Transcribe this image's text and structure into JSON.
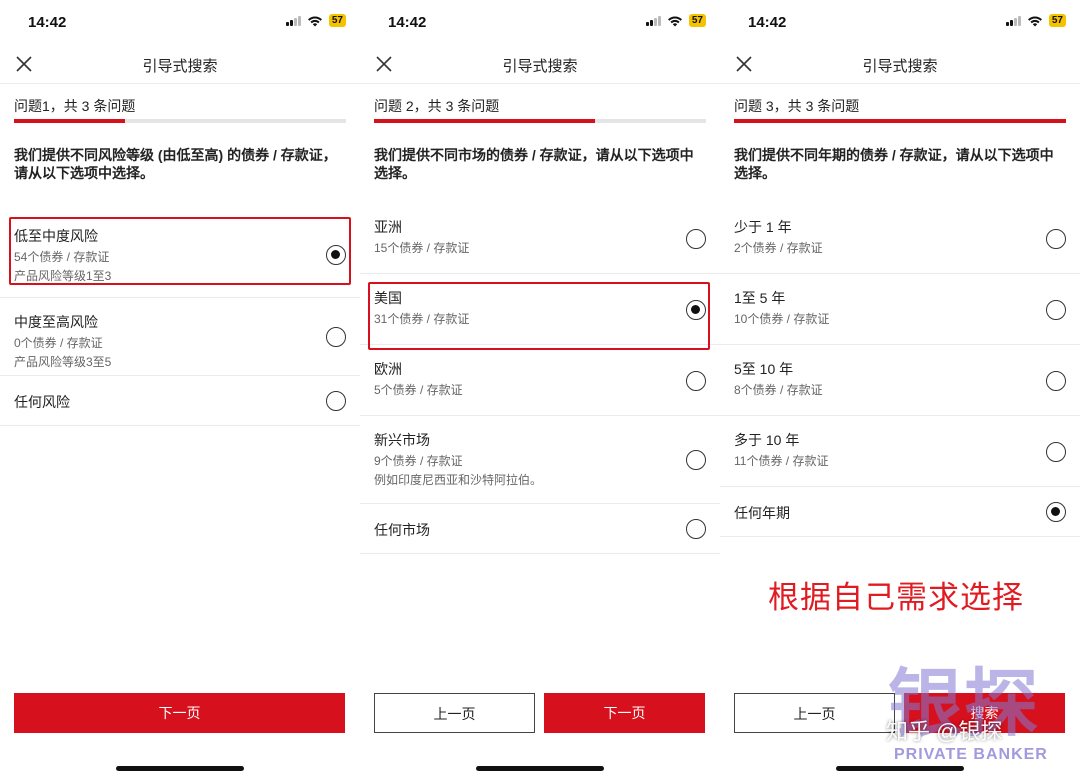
{
  "status": {
    "time": "14:42",
    "battery": "57"
  },
  "screens": [
    {
      "nav_title": "引导式搜索",
      "question_label": "问题1，共 3 条问题",
      "progress": 0.333,
      "intro": "我们提供不同风险等级 (由低至高) 的债券 / 存款证，请从以下选项中选择。",
      "options": [
        {
          "title": "低至中度风险",
          "sub1": "54个债券 / 存款证",
          "sub2": "产品风险等级1至3",
          "selected": true,
          "highlighted": true
        },
        {
          "title": "中度至高风险",
          "sub1": "0个债券 / 存款证",
          "sub2": "产品风险等级3至5",
          "selected": false
        },
        {
          "title": "任何风险",
          "selected": false
        }
      ],
      "buttons": [
        {
          "label": "下一页",
          "kind": "primary"
        }
      ]
    },
    {
      "nav_title": "引导式搜索",
      "question_label": "问题 2，共 3 条问题",
      "progress": 0.667,
      "intro": "我们提供不同市场的债券 / 存款证，请从以下选项中选择。",
      "options": [
        {
          "title": "亚洲",
          "sub1": "15个债券 / 存款证",
          "selected": false
        },
        {
          "title": "美国",
          "sub1": "31个债券 / 存款证",
          "selected": true,
          "highlighted": true
        },
        {
          "title": "欧洲",
          "sub1": "5个债券 / 存款证",
          "selected": false
        },
        {
          "title": "新兴市场",
          "sub1": "9个债券 / 存款证",
          "sub2": "例如印度尼西亚和沙特阿拉伯。",
          "selected": false
        },
        {
          "title": "任何市场",
          "selected": false
        }
      ],
      "buttons": [
        {
          "label": "上一页",
          "kind": "secondary"
        },
        {
          "label": "下一页",
          "kind": "primary"
        }
      ]
    },
    {
      "nav_title": "引导式搜索",
      "question_label": "问题 3，共 3 条问题",
      "progress": 1.0,
      "intro": "我们提供不同年期的债券 / 存款证，请从以下选项中选择。",
      "options": [
        {
          "title": "少于 1 年",
          "sub1": "2个债券 / 存款证",
          "selected": false
        },
        {
          "title": "1至 5 年",
          "sub1": "10个债券 / 存款证",
          "selected": false
        },
        {
          "title": "5至 10 年",
          "sub1": "8个债券 / 存款证",
          "selected": false
        },
        {
          "title": "多于 10 年",
          "sub1": "11个债券 / 存款证",
          "selected": false
        },
        {
          "title": "任何年期",
          "selected": true
        }
      ],
      "buttons": [
        {
          "label": "上一页",
          "kind": "secondary"
        },
        {
          "label": "搜索",
          "kind": "primary"
        }
      ]
    }
  ],
  "annotation": "根据自己需求选择",
  "watermark": {
    "logo": "银探",
    "handle": "知乎 @银探",
    "tagline": "PRIVATE BANKER"
  },
  "colors": {
    "accent": "#d7101d",
    "annotation": "#e01b22",
    "watermark": "#8278d2"
  }
}
